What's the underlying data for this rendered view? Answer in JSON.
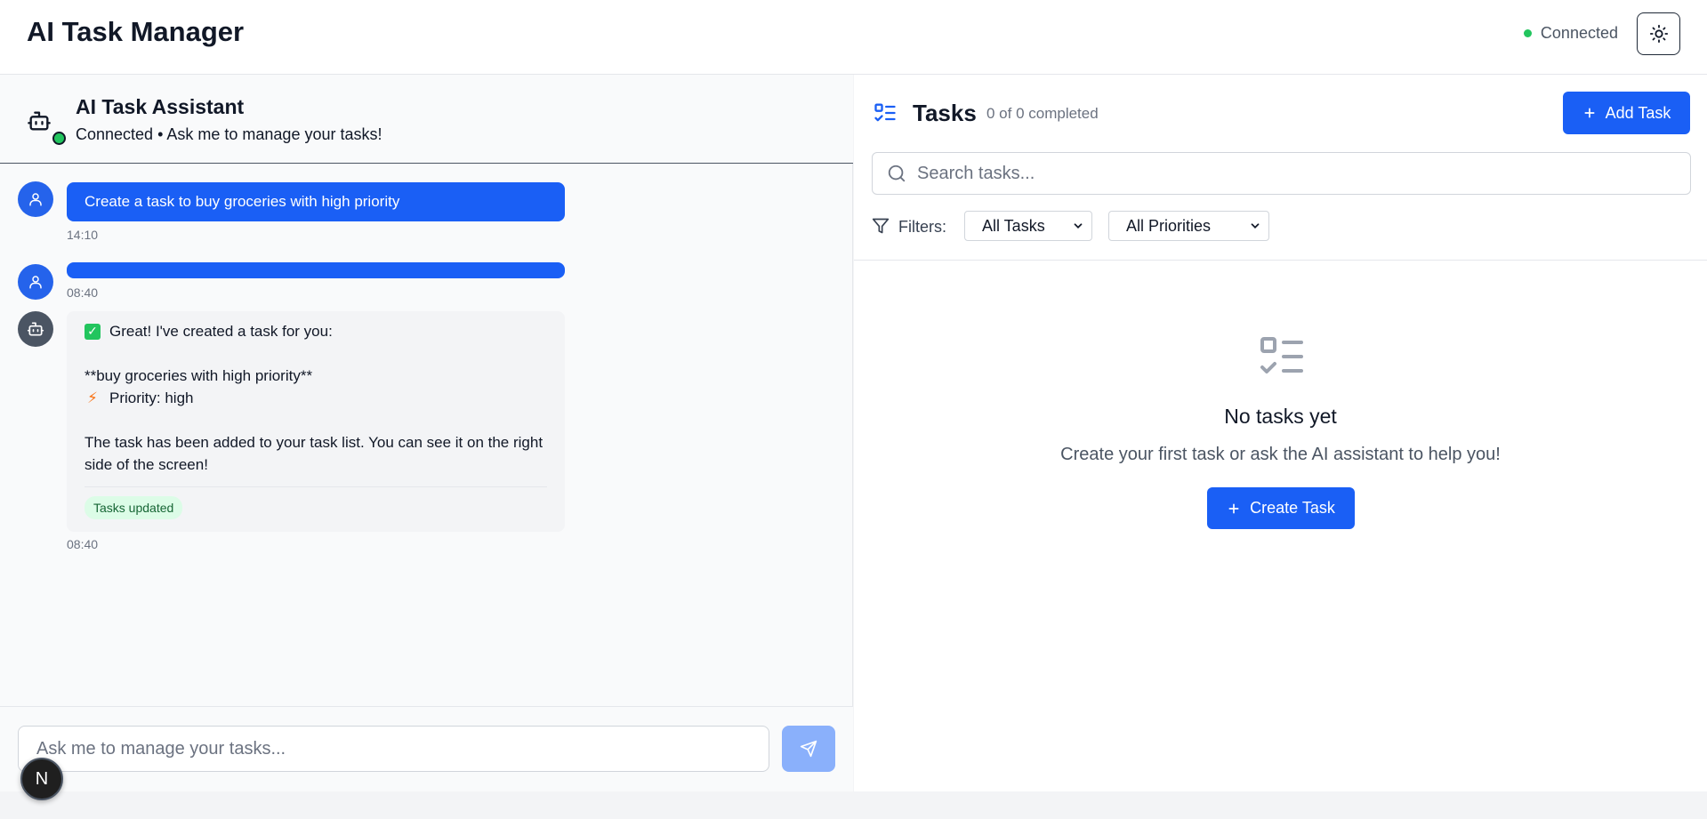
{
  "header": {
    "app_title": "AI Task Manager",
    "connection_status": "Connected",
    "theme_toggle_icon": "sun-icon"
  },
  "chat": {
    "assistant_title": "AI Task Assistant",
    "assistant_subtitle": "Connected • Ask me to manage your tasks!",
    "messages": [
      {
        "role": "user",
        "text": "Create a task to buy groceries with high priority",
        "time": "14:10"
      },
      {
        "role": "user",
        "text": "",
        "time": "08:40"
      },
      {
        "role": "assistant",
        "line1": "Great! I've created a task for you:",
        "line2": "**buy groceries with high priority**",
        "line3": "Priority: high",
        "line4": "The task has been added to your task list. You can see it on the right side of the screen!",
        "tag": "Tasks updated",
        "time": "08:40"
      }
    ],
    "input_placeholder": "Ask me to manage your tasks...",
    "badge_letter": "N"
  },
  "tasks": {
    "title": "Tasks",
    "count": "0 of 0 completed",
    "add_label": "Add Task",
    "search_placeholder": "Search tasks...",
    "filters_label": "Filters:",
    "status_filter": "All Tasks",
    "priority_filter": "All Priorities",
    "empty_title": "No tasks yet",
    "empty_subtitle": "Create your first task or ask the AI assistant to help you!",
    "create_label": "Create Task"
  },
  "colors": {
    "primary": "#1a5ff5",
    "online": "#22c55e",
    "send_disabled": "#8ab0fb"
  }
}
